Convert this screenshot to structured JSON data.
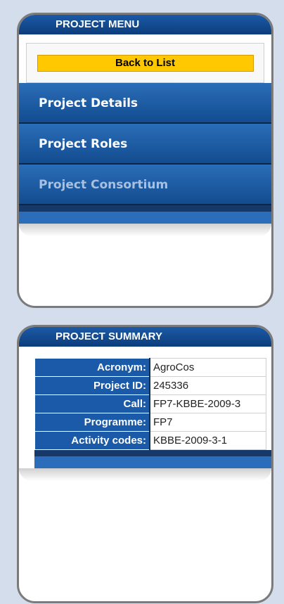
{
  "menu": {
    "header": "PROJECT MENU",
    "back_label": "Back to List",
    "items": [
      {
        "label": "Project Details"
      },
      {
        "label": "Project Roles"
      },
      {
        "label": "Project Consortium"
      }
    ]
  },
  "summary": {
    "header": "PROJECT SUMMARY",
    "rows": [
      {
        "key": "Acronym:",
        "value": "AgroCos"
      },
      {
        "key": "Project ID:",
        "value": "245336"
      },
      {
        "key": "Call:",
        "value": "FP7-KBBE-2009-3"
      },
      {
        "key": "Programme:",
        "value": "FP7"
      },
      {
        "key": "Activity codes:",
        "value": "KBBE-2009-3-1"
      }
    ]
  },
  "colors": {
    "header_blue": "#0c3d7c",
    "button_yellow": "#ffc800",
    "menu_blue": "#1b5aa8",
    "inactive_text": "#a9c0de"
  }
}
